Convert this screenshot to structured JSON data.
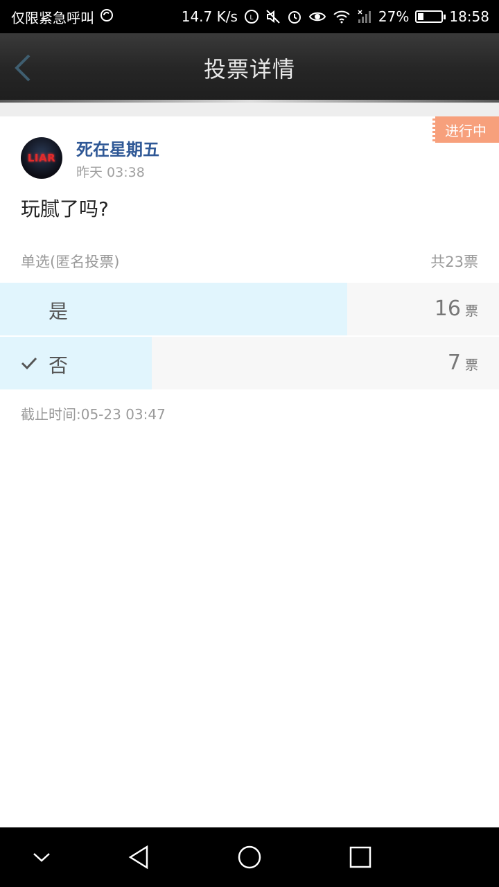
{
  "status_bar": {
    "carrier": "仅限紧急呼叫",
    "speed": "14.7 K/s",
    "battery": "27%",
    "battery_level": 0.27,
    "time": "18:58"
  },
  "header": {
    "title": "投票详情"
  },
  "poll": {
    "badge": "进行中",
    "author": "死在星期五",
    "avatar_text": "LIAR",
    "time": "昨天 03:38",
    "question": "玩腻了吗?",
    "type_label": "单选(匿名投票)",
    "total_label": "共23票",
    "options": [
      {
        "label": "是",
        "count": "16",
        "unit": "票",
        "share": 0.6956,
        "selected": false
      },
      {
        "label": "否",
        "count": "7",
        "unit": "票",
        "share": 0.3043,
        "selected": true
      }
    ],
    "deadline": "截止时间:05-23 03:47"
  },
  "colors": {
    "accent_blue": "#2f5896",
    "bar_fill": "#e1f5fd",
    "badge": "#f7a07c"
  },
  "icons": [
    "back-icon",
    "check-icon",
    "nav-collapse-icon",
    "nav-back-icon",
    "nav-home-icon",
    "nav-recents-icon"
  ]
}
